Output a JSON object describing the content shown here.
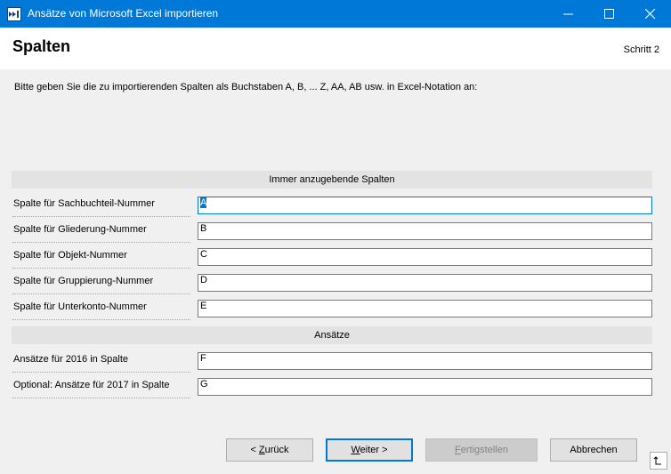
{
  "window": {
    "title": "Ansätze von Microsoft Excel importieren",
    "icons": {
      "app": "import-arrow-icon",
      "minimize": "minimize-icon",
      "maximize": "maximize-icon",
      "close": "close-icon"
    }
  },
  "header": {
    "title": "Spalten",
    "step": "Schritt 2"
  },
  "instruction": "Bitte geben Sie die zu importierenden Spalten als Buchstaben A, B, ... Z, AA, AB usw. in Excel-Notation an:",
  "sections": {
    "always": {
      "title": "Immer anzugebende Spalten",
      "rows": [
        {
          "label": "Spalte für Sachbuchteil-Nummer",
          "value": "A"
        },
        {
          "label": "Spalte für Gliederung-Nummer",
          "value": "B"
        },
        {
          "label": "Spalte für Objekt-Nummer",
          "value": "C"
        },
        {
          "label": "Spalte für Gruppierung-Nummer",
          "value": "D"
        },
        {
          "label": "Spalte für Unterkonto-Nummer",
          "value": "E"
        }
      ]
    },
    "ansaetze": {
      "title": "Ansätze",
      "rows": [
        {
          "label": "Ansätze für 2016 in Spalte",
          "value": "F"
        },
        {
          "label": "Optional: Ansätze für 2017 in Spalte",
          "value": "G"
        }
      ]
    }
  },
  "buttons": {
    "back_prefix": "< ",
    "back_mnemonic": "Z",
    "back_rest": "urück",
    "next_mnemonic": "W",
    "next_rest": "eiter >",
    "finish_mnemonic": "F",
    "finish_rest": "ertigstellen",
    "cancel": "Abbrechen"
  },
  "colors": {
    "titlebar": "#0078d7",
    "content_bg": "#f0f0f0",
    "focus": "#0078d7"
  }
}
